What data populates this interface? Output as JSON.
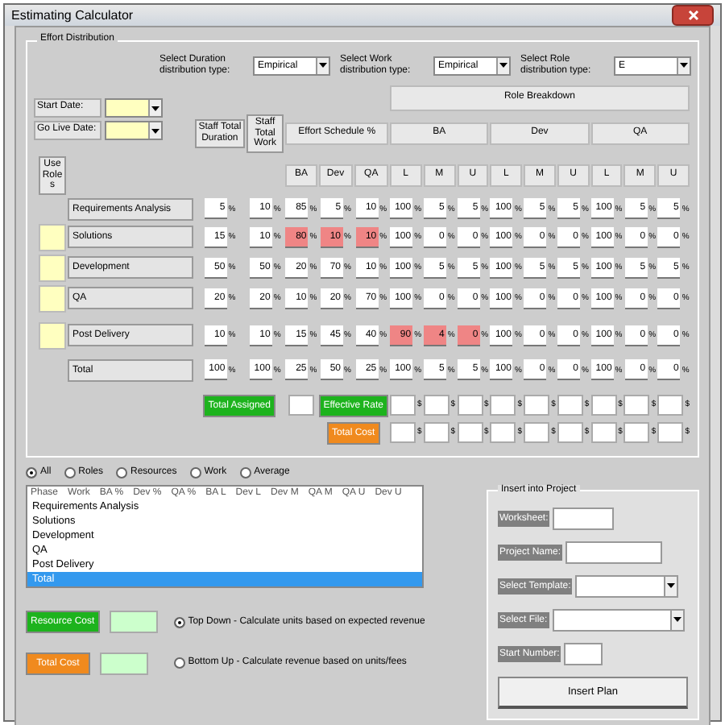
{
  "window": {
    "title": "Estimating Calculator"
  },
  "effort": {
    "title": "Effort Distribution",
    "selects": [
      {
        "label": "Select Duration distribution type:",
        "value": "Empirical"
      },
      {
        "label": "Select Work distribution type:",
        "value": "Empirical"
      },
      {
        "label": "Select Role distribution type:",
        "value": "E"
      }
    ],
    "start_date": "Start Date:",
    "go_live": "Go Live Date:",
    "use_roles": "Use Roles",
    "duration_header": "Staff Total Duration",
    "work_header": "Staff Total Work",
    "schedule_header": "Effort Schedule %",
    "role_header": "Role Breakdown",
    "roles": [
      {
        "name": "BA",
        "subs": [
          "L",
          "M",
          "U"
        ]
      },
      {
        "name": "Dev",
        "subs": [
          "L",
          "M",
          "U"
        ]
      },
      {
        "name": "QA",
        "subs": [
          "L",
          "M",
          "U"
        ]
      }
    ],
    "schedule_columns": [
      "BA",
      "Dev",
      "QA"
    ],
    "unit": "%",
    "money": "$",
    "rows": [
      {
        "name": "Requirements Analysis",
        "swatch": false,
        "duration": "5",
        "work": "10",
        "schedule": [
          {
            "v": "85",
            "alert": false
          },
          {
            "v": "5",
            "alert": false
          },
          {
            "v": "10",
            "alert": false
          }
        ],
        "breakdown": [
          {
            "v": "100",
            "alert": false
          },
          {
            "v": "5",
            "alert": false
          },
          {
            "v": "5",
            "alert": false
          },
          {
            "v": "100",
            "alert": false
          },
          {
            "v": "5",
            "alert": false
          },
          {
            "v": "5",
            "alert": false
          },
          {
            "v": "100",
            "alert": false
          },
          {
            "v": "5",
            "alert": false
          },
          {
            "v": "5",
            "alert": false
          }
        ]
      },
      {
        "name": "Solutions",
        "swatch": true,
        "duration": "15",
        "work": "10",
        "schedule": [
          {
            "v": "80",
            "alert": true
          },
          {
            "v": "10",
            "alert": true
          },
          {
            "v": "10",
            "alert": true
          }
        ],
        "breakdown": [
          {
            "v": "100",
            "alert": false
          },
          {
            "v": "0",
            "alert": false
          },
          {
            "v": "0",
            "alert": false
          },
          {
            "v": "100",
            "alert": false
          },
          {
            "v": "0",
            "alert": false
          },
          {
            "v": "0",
            "alert": false
          },
          {
            "v": "100",
            "alert": false
          },
          {
            "v": "0",
            "alert": false
          },
          {
            "v": "0",
            "alert": false
          }
        ]
      },
      {
        "name": "Development",
        "swatch": true,
        "duration": "50",
        "work": "50",
        "schedule": [
          {
            "v": "20",
            "alert": false
          },
          {
            "v": "70",
            "alert": false
          },
          {
            "v": "10",
            "alert": false
          }
        ],
        "breakdown": [
          {
            "v": "100",
            "alert": false
          },
          {
            "v": "5",
            "alert": false
          },
          {
            "v": "5",
            "alert": false
          },
          {
            "v": "100",
            "alert": false
          },
          {
            "v": "5",
            "alert": false
          },
          {
            "v": "5",
            "alert": false
          },
          {
            "v": "100",
            "alert": false
          },
          {
            "v": "5",
            "alert": false
          },
          {
            "v": "5",
            "alert": false
          }
        ]
      },
      {
        "name": "QA",
        "swatch": true,
        "duration": "20",
        "work": "20",
        "schedule": [
          {
            "v": "10",
            "alert": false
          },
          {
            "v": "20",
            "alert": false
          },
          {
            "v": "70",
            "alert": false
          }
        ],
        "breakdown": [
          {
            "v": "100",
            "alert": false
          },
          {
            "v": "0",
            "alert": false
          },
          {
            "v": "0",
            "alert": false
          },
          {
            "v": "100",
            "alert": false
          },
          {
            "v": "0",
            "alert": false
          },
          {
            "v": "0",
            "alert": false
          },
          {
            "v": "100",
            "alert": false
          },
          {
            "v": "0",
            "alert": false
          },
          {
            "v": "0",
            "alert": false
          }
        ]
      },
      {
        "name": "Post Delivery",
        "swatch": true,
        "duration": "10",
        "work": "10",
        "schedule": [
          {
            "v": "15",
            "alert": false
          },
          {
            "v": "45",
            "alert": false
          },
          {
            "v": "40",
            "alert": false
          }
        ],
        "breakdown": [
          {
            "v": "90",
            "alert": true
          },
          {
            "v": "4",
            "alert": true
          },
          {
            "v": "0",
            "alert": true
          },
          {
            "v": "100",
            "alert": false
          },
          {
            "v": "0",
            "alert": false
          },
          {
            "v": "0",
            "alert": false
          },
          {
            "v": "100",
            "alert": false
          },
          {
            "v": "0",
            "alert": false
          },
          {
            "v": "0",
            "alert": false
          }
        ]
      },
      {
        "name": "Total",
        "swatch": false,
        "duration": "100",
        "work": "100",
        "schedule": [
          {
            "v": "25",
            "alert": false
          },
          {
            "v": "50",
            "alert": false
          },
          {
            "v": "25",
            "alert": false
          }
        ],
        "breakdown": [
          {
            "v": "100",
            "alert": false
          },
          {
            "v": "5",
            "alert": false
          },
          {
            "v": "5",
            "alert": false
          },
          {
            "v": "100",
            "alert": false
          },
          {
            "v": "0",
            "alert": false
          },
          {
            "v": "0",
            "alert": false
          },
          {
            "v": "100",
            "alert": false
          },
          {
            "v": "0",
            "alert": false
          },
          {
            "v": "0",
            "alert": false
          }
        ]
      }
    ],
    "total_assigned": "Total Assigned",
    "effective_rate": "Effective Rate",
    "total_cost": "Total Cost"
  },
  "filters": [
    {
      "label": "All",
      "selected": true
    },
    {
      "label": "Roles",
      "selected": false
    },
    {
      "label": "Resources",
      "selected": false
    },
    {
      "label": "Work",
      "selected": false
    },
    {
      "label": "Average",
      "selected": false
    }
  ],
  "list": {
    "columns": [
      "Phase",
      "Work",
      "BA %",
      "Dev %",
      "QA %",
      "BA L",
      "Dev L",
      "Dev M",
      "QA M",
      "QA U",
      "Dev U"
    ],
    "rows": [
      {
        "label": "Requirements Analysis",
        "selected": false
      },
      {
        "label": "Solutions",
        "selected": false
      },
      {
        "label": "Development",
        "selected": false
      },
      {
        "label": "QA",
        "selected": false
      },
      {
        "label": "Post Delivery",
        "selected": false
      },
      {
        "label": "Total",
        "selected": true
      }
    ]
  },
  "costs": [
    {
      "label": "Resource Cost",
      "kind": "green"
    },
    {
      "label": "Total Cost",
      "kind": "orange"
    }
  ],
  "methods": [
    {
      "label": "Top Down - Calculate units based on expected revenue",
      "selected": true
    },
    {
      "label": "Bottom Up - Calculate revenue based on units/fees",
      "selected": false
    }
  ],
  "insert": {
    "title": "Insert into Project",
    "fields": [
      {
        "label": "Worksheet:",
        "kind": "short"
      },
      {
        "label": "Project Name:",
        "kind": "text"
      },
      {
        "label": "Select Template:",
        "kind": "select"
      },
      {
        "label": "Select File:",
        "kind": "wideselect"
      },
      {
        "label": "Start Number:",
        "kind": "tiny"
      }
    ],
    "button": "Insert Plan"
  }
}
